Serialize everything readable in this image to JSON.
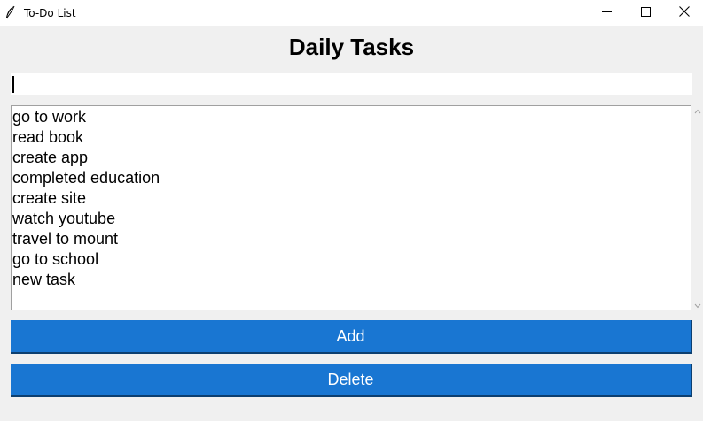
{
  "window": {
    "title": "To-Do List",
    "icon": "feather-icon",
    "controls": [
      "minimize-icon",
      "maximize-icon",
      "close-icon"
    ]
  },
  "header": {
    "title": "Daily Tasks"
  },
  "input": {
    "value": "",
    "placeholder": ""
  },
  "tasks": [
    "go to work",
    "read book",
    "create app",
    "completed education",
    "create site",
    "watch youtube",
    "travel to mount",
    "go to school",
    "new task"
  ],
  "buttons": {
    "add_label": "Add",
    "delete_label": "Delete"
  },
  "colors": {
    "button_bg": "#1976d2",
    "button_text": "#ffffff",
    "background": "#f0f0f0"
  }
}
